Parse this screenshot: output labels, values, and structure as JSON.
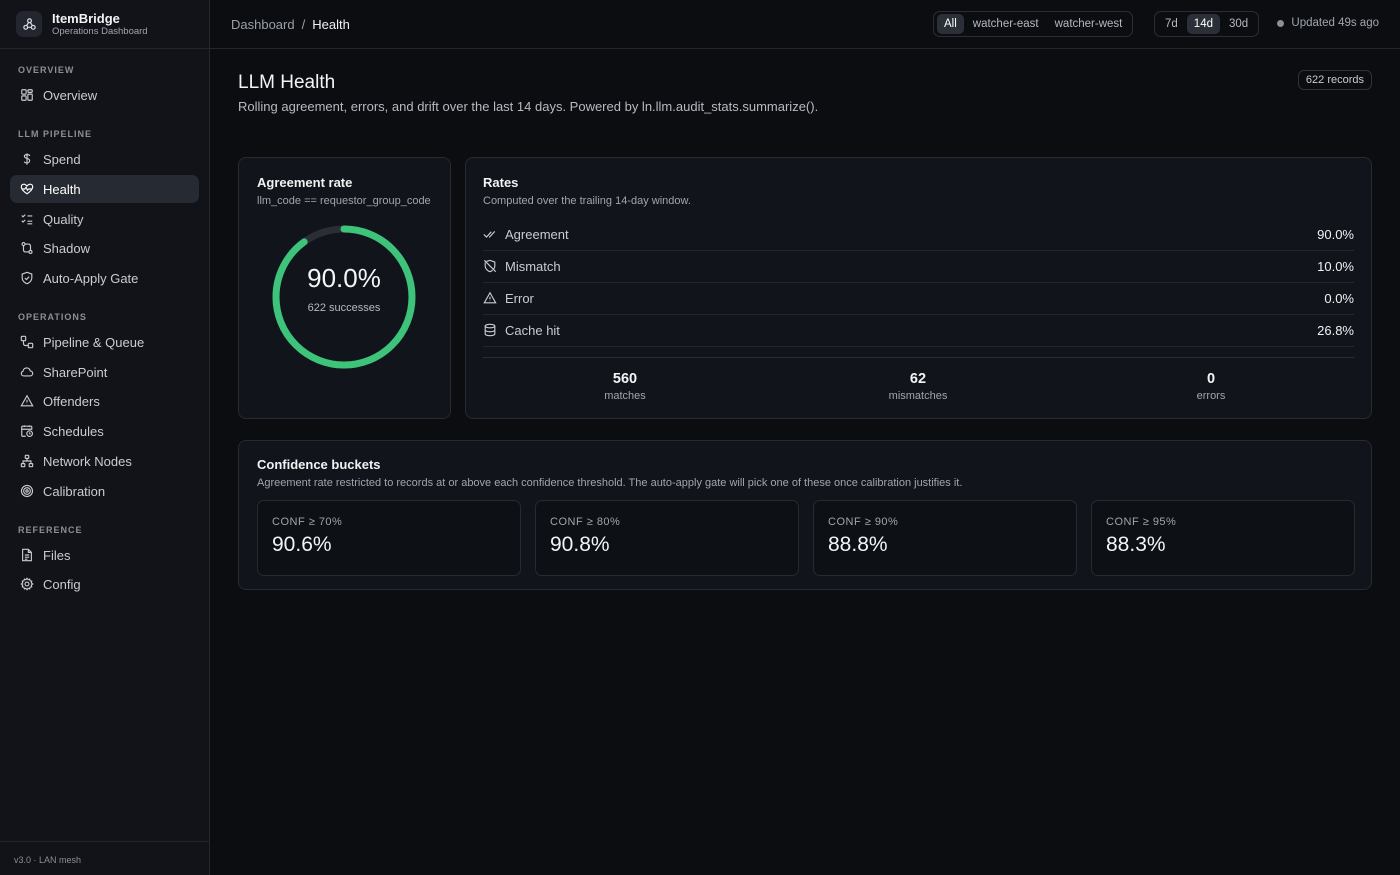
{
  "brand": {
    "name": "ItemBridge",
    "subtitle": "Operations Dashboard"
  },
  "sidebar": {
    "sections": [
      {
        "label": "OVERVIEW"
      },
      {
        "label": "LLM PIPELINE"
      },
      {
        "label": "OPERATIONS"
      },
      {
        "label": "REFERENCE"
      }
    ],
    "items": [
      {
        "label": "Overview",
        "icon": "grid-icon"
      },
      {
        "label": "Spend",
        "icon": "dollar-icon"
      },
      {
        "label": "Health",
        "icon": "heart-pulse-icon",
        "active": true
      },
      {
        "label": "Quality",
        "icon": "checklist-icon"
      },
      {
        "label": "Shadow",
        "icon": "git-compare-icon"
      },
      {
        "label": "Auto-Apply Gate",
        "icon": "shield-check-icon"
      },
      {
        "label": "Pipeline & Queue",
        "icon": "workflow-icon"
      },
      {
        "label": "SharePoint",
        "icon": "cloud-icon"
      },
      {
        "label": "Offenders",
        "icon": "warning-icon"
      },
      {
        "label": "Schedules",
        "icon": "calendar-clock-icon"
      },
      {
        "label": "Network Nodes",
        "icon": "network-icon"
      },
      {
        "label": "Calibration",
        "icon": "target-icon"
      },
      {
        "label": "Files",
        "icon": "file-icon"
      },
      {
        "label": "Config",
        "icon": "gear-icon"
      }
    ],
    "version": "v3.0 · LAN mesh"
  },
  "topbar": {
    "breadcrumb": {
      "root": "Dashboard",
      "sep": "/",
      "current": "Health"
    },
    "watchers": [
      "All",
      "watcher-east",
      "watcher-west"
    ],
    "watcher_selected": "All",
    "ranges": [
      "7d",
      "14d",
      "30d"
    ],
    "range_selected": "14d",
    "updated": "Updated 49s ago"
  },
  "page": {
    "title": "LLM Health",
    "description": "Rolling agreement, errors, and drift over the last 14 days. Powered by ln.llm.audit_stats.summarize().",
    "records": "622 records"
  },
  "agreement": {
    "title": "Agreement rate",
    "subtitle": "llm_code == requestor_group_code",
    "value": "90.0%",
    "fraction": 0.9,
    "caption": "622 successes",
    "color": "#3ec47a"
  },
  "rates": {
    "title": "Rates",
    "subtitle": "Computed over the trailing 14-day window.",
    "rows": [
      {
        "label": "Agreement",
        "value": "90.0%",
        "icon": "double-check-icon"
      },
      {
        "label": "Mismatch",
        "value": "10.0%",
        "icon": "shield-off-icon"
      },
      {
        "label": "Error",
        "value": "0.0%",
        "icon": "warning-icon"
      },
      {
        "label": "Cache hit",
        "value": "26.8%",
        "icon": "database-icon"
      }
    ],
    "stats": [
      {
        "value": "560",
        "label": "matches"
      },
      {
        "value": "62",
        "label": "mismatches"
      },
      {
        "value": "0",
        "label": "errors"
      }
    ]
  },
  "buckets": {
    "title": "Confidence buckets",
    "subtitle": "Agreement rate restricted to records at or above each confidence threshold. The auto-apply gate will pick one of these once calibration justifies it.",
    "items": [
      {
        "label": "CONF ≥ 70%",
        "value": "90.6%"
      },
      {
        "label": "CONF ≥ 80%",
        "value": "90.8%"
      },
      {
        "label": "CONF ≥ 90%",
        "value": "88.8%"
      },
      {
        "label": "CONF ≥ 95%",
        "value": "88.3%"
      }
    ]
  }
}
